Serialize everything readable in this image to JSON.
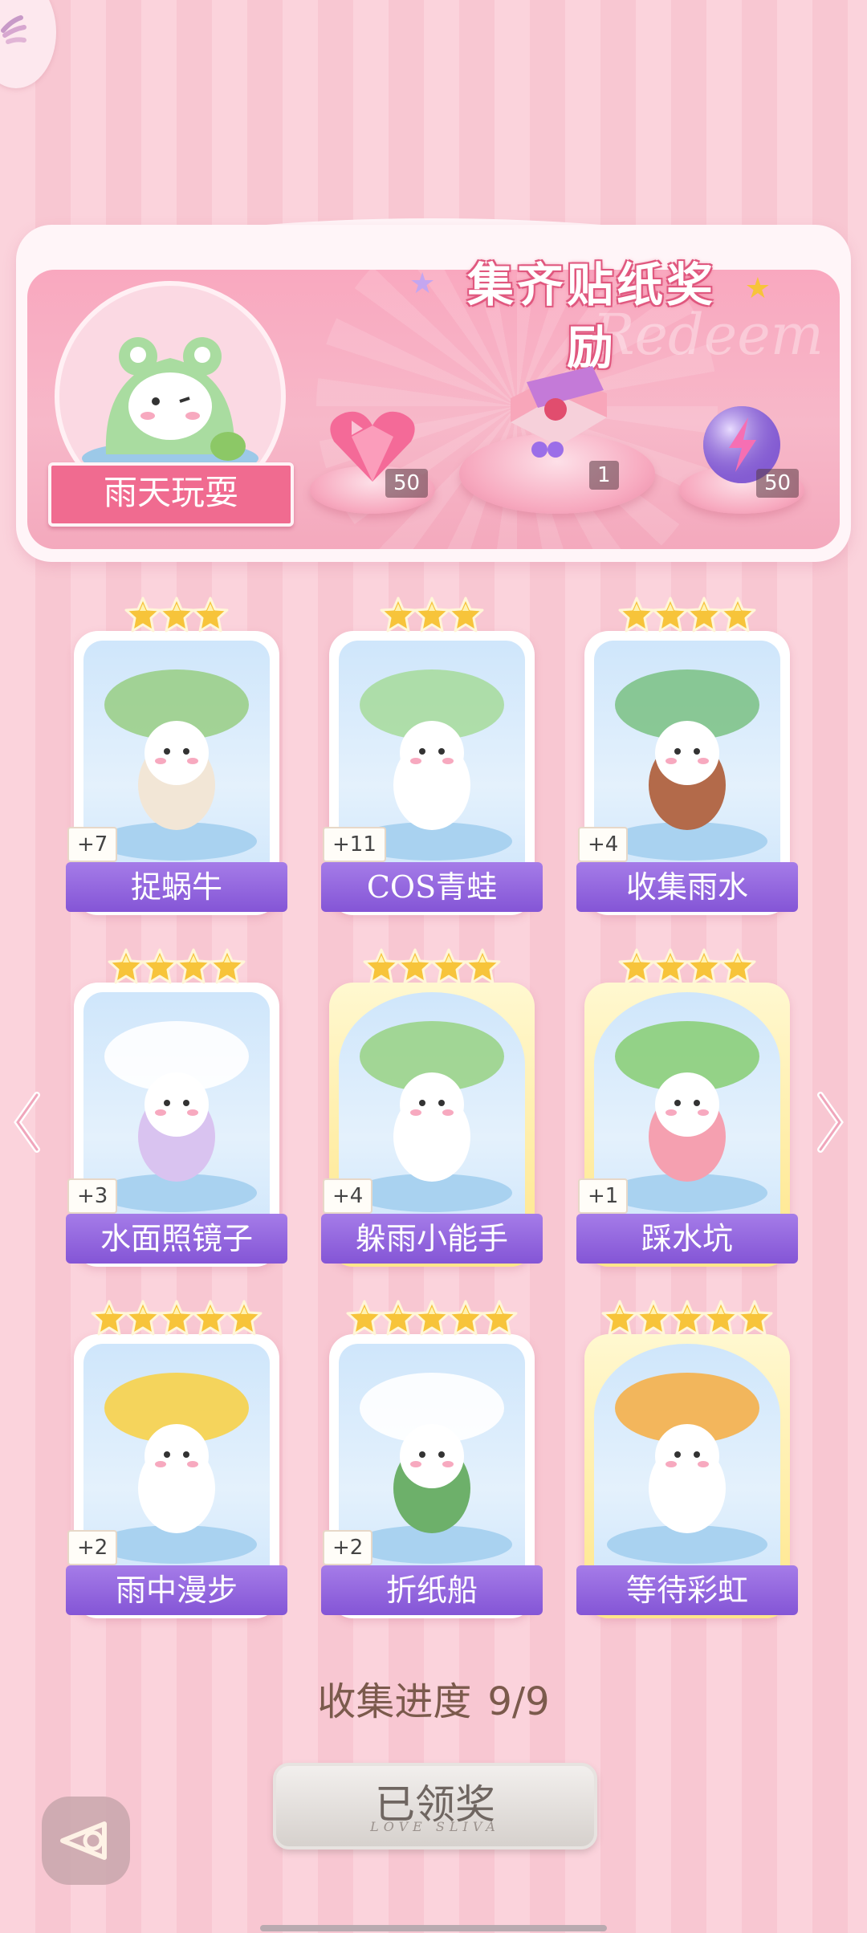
{
  "banner": {
    "title": "集齐贴纸奖励",
    "watermark": "Redeem",
    "album_name": "雨天玩耍",
    "rewards": [
      {
        "icon": "heart-gem-icon",
        "count": "50"
      },
      {
        "icon": "gift-box-icon",
        "count": "1"
      },
      {
        "icon": "lightning-orb-icon",
        "count": "50"
      }
    ]
  },
  "stickers": [
    {
      "name": "捉蜗牛",
      "bonus": "+7",
      "stars": 3,
      "rarity": "normal"
    },
    {
      "name": "COS青蛙",
      "bonus": "+11",
      "stars": 3,
      "rarity": "normal"
    },
    {
      "name": "收集雨水",
      "bonus": "+4",
      "stars": 4,
      "rarity": "normal"
    },
    {
      "name": "水面照镜子",
      "bonus": "+3",
      "stars": 4,
      "rarity": "normal"
    },
    {
      "name": "躲雨小能手",
      "bonus": "+4",
      "stars": 4,
      "rarity": "gold"
    },
    {
      "name": "踩水坑",
      "bonus": "+1",
      "stars": 4,
      "rarity": "gold"
    },
    {
      "name": "雨中漫步",
      "bonus": "+2",
      "stars": 5,
      "rarity": "normal"
    },
    {
      "name": "折纸船",
      "bonus": "+2",
      "stars": 5,
      "rarity": "normal"
    },
    {
      "name": "等待彩虹",
      "bonus": "",
      "stars": 5,
      "rarity": "gold"
    }
  ],
  "progress": {
    "label": "收集进度",
    "value": "9/9",
    "collected": 9,
    "total": 9
  },
  "claim_button": {
    "label": "已领奖",
    "subtitle": "LOVE SLIVA"
  },
  "colors": {
    "accent_purple": "#8455d6",
    "banner_pink": "#f9a8bf",
    "star_gold": "#f7c43a"
  }
}
